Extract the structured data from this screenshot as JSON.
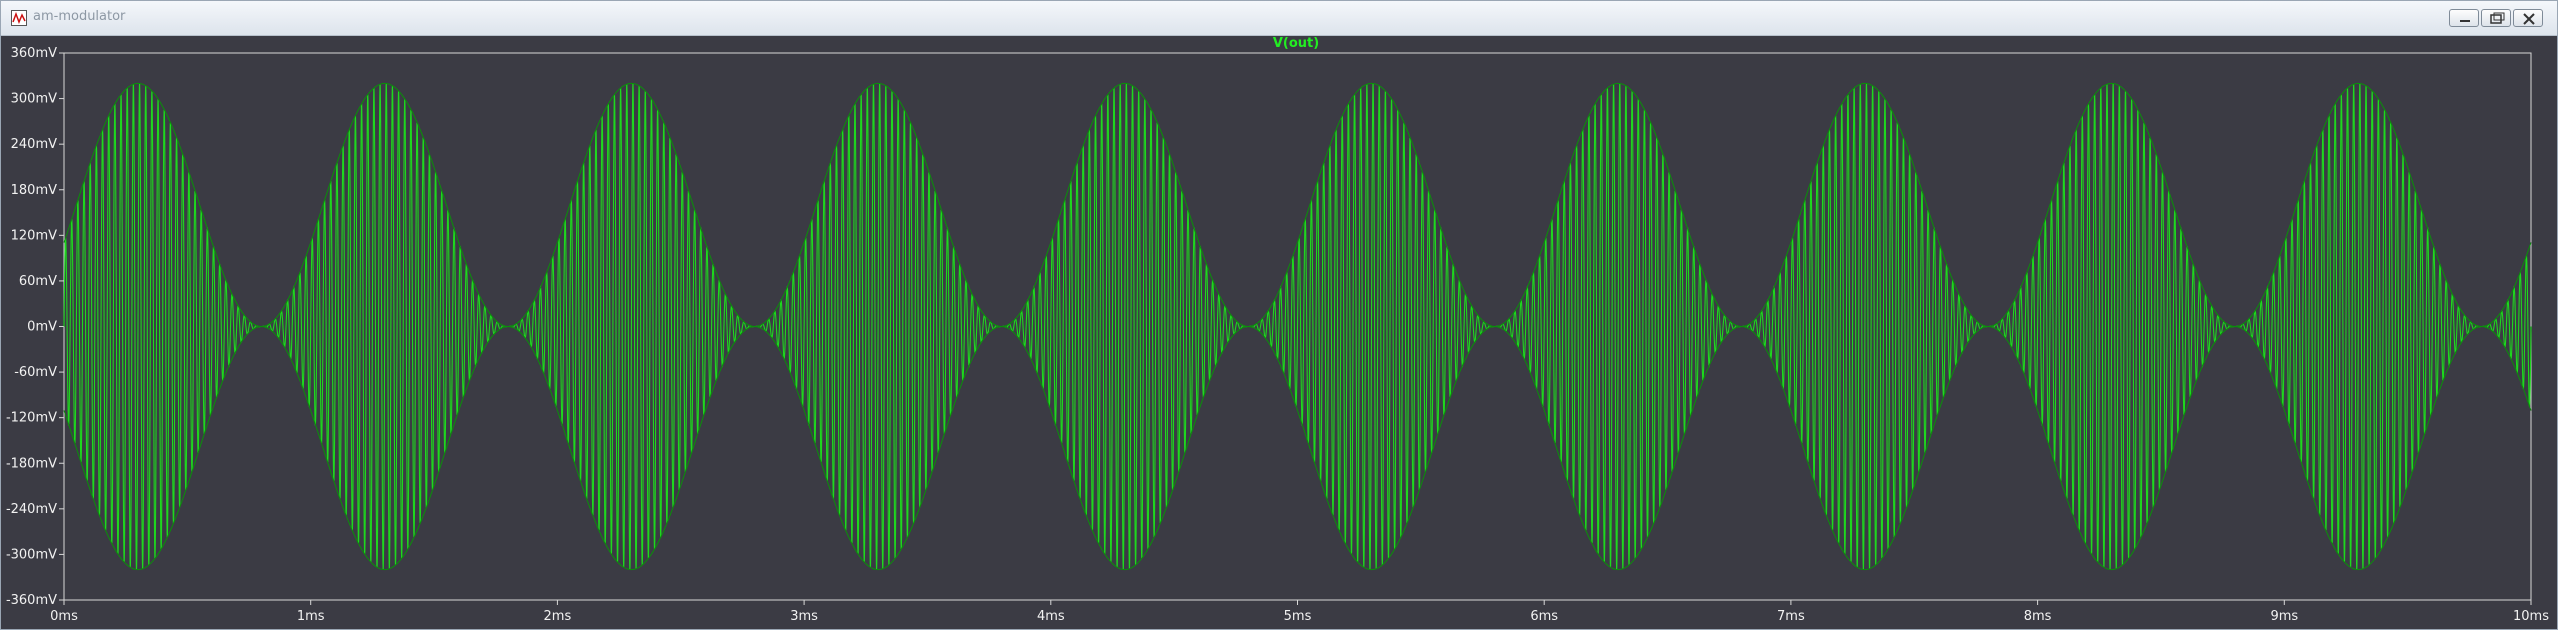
{
  "window": {
    "title": "am-modulator",
    "icon": "waveform-icon",
    "buttons": [
      "minimize-icon",
      "restore-icon",
      "close-icon"
    ]
  },
  "colors": {
    "plot_background": "#3b3b44",
    "trace": "#1ed81e",
    "trace_dark": "#0a8f0a",
    "axis_text": "#f2f2f2"
  },
  "chart_data": {
    "type": "line",
    "title": "V(out)",
    "xlabel": "",
    "ylabel": "",
    "x_ticks": [
      "0ms",
      "1ms",
      "2ms",
      "3ms",
      "4ms",
      "5ms",
      "6ms",
      "7ms",
      "8ms",
      "9ms",
      "10ms"
    ],
    "y_ticks": [
      "360mV",
      "300mV",
      "240mV",
      "180mV",
      "120mV",
      "60mV",
      "0mV",
      "-60mV",
      "-120mV",
      "-180mV",
      "-240mV",
      "-300mV",
      "-360mV"
    ],
    "xlim": [
      0,
      10
    ],
    "ylim": [
      -360,
      360
    ],
    "x_unit": "ms",
    "y_unit": "mV",
    "series": [
      {
        "name": "V(out)",
        "signal": "AM modulated carrier",
        "envelope_peak": 320,
        "modulation_frequency_khz": 1,
        "carrier_frequency_khz": 40,
        "envelope_peak_times_ms": [
          0.3,
          1.3,
          2.3,
          3.3,
          4.3,
          5.3,
          6.3,
          7.3,
          8.3,
          9.3
        ],
        "envelope_null_times_ms": [
          0.8,
          1.8,
          2.8,
          3.8,
          4.8,
          5.8,
          6.8,
          7.8,
          8.8,
          9.8
        ]
      }
    ],
    "grid": false,
    "legend": "none"
  }
}
